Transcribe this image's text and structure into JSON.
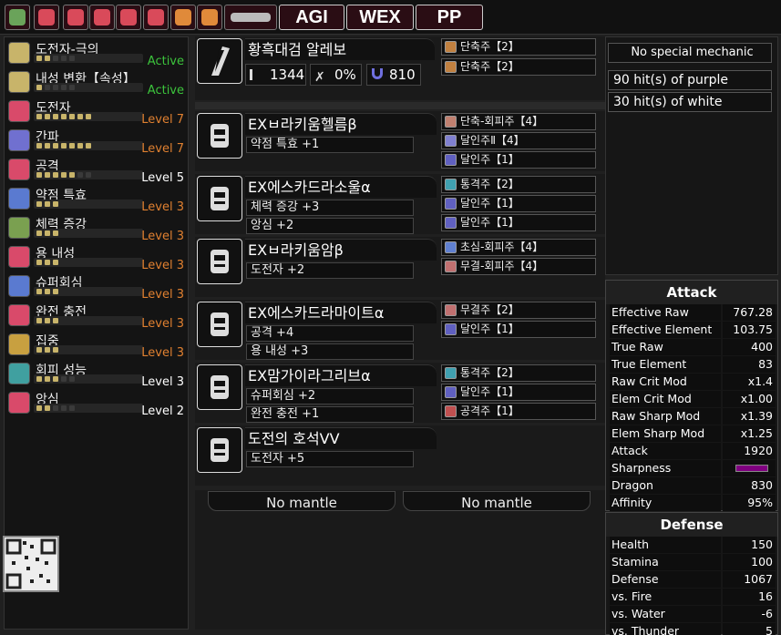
{
  "topbar": {
    "icons": [
      {
        "name": "slot-icon",
        "color": "#6aa35a"
      },
      {
        "name": "spoon-icon",
        "color": "#d94a5a"
      },
      {
        "name": "book-icon",
        "color": "#d94a5a"
      },
      {
        "name": "potion-icon",
        "color": "#d94a5a"
      },
      {
        "name": "pot-icon",
        "color": "#d94a5a"
      },
      {
        "name": "heart-icon",
        "color": "#d94a5a"
      },
      {
        "name": "flask-icon",
        "color": "#e08a3a"
      },
      {
        "name": "mustache-icon",
        "color": "#e08a3a"
      },
      {
        "name": "hammer-icon",
        "color": "#bbbbbb"
      }
    ],
    "buttons": [
      "AGI",
      "WEX",
      "PP"
    ]
  },
  "skills": [
    {
      "name": "도전자-극의",
      "level": "Active",
      "pips": [
        1,
        1,
        0,
        0,
        0
      ],
      "color": "#c8b46a",
      "level_color": "#3cc43c"
    },
    {
      "name": "내성 변환【속성】",
      "level": "Active",
      "pips": [
        1,
        0,
        0,
        0,
        0
      ],
      "color": "#c8b46a",
      "level_color": "#3cc43c"
    },
    {
      "name": "도전자",
      "level": "Level 7",
      "pips": [
        1,
        1,
        1,
        1,
        1,
        1,
        1
      ],
      "color": "#d94a6a",
      "level_color": "#e08030"
    },
    {
      "name": "간파",
      "level": "Level 7",
      "pips": [
        1,
        1,
        1,
        1,
        1,
        1,
        1
      ],
      "color": "#7070d0",
      "level_color": "#e08030"
    },
    {
      "name": "공격",
      "level": "Level 5",
      "pips": [
        1,
        1,
        1,
        1,
        1,
        0,
        0
      ],
      "color": "#d94a6a",
      "level_color": "#ffffff"
    },
    {
      "name": "약점 특효",
      "level": "Level 3",
      "pips": [
        1,
        1,
        1
      ],
      "color": "#5a7ad0",
      "level_color": "#e08030"
    },
    {
      "name": "체력 증강",
      "level": "Level 3",
      "pips": [
        1,
        1,
        1
      ],
      "color": "#7aa050",
      "level_color": "#e08030"
    },
    {
      "name": "용 내성",
      "level": "Level 3",
      "pips": [
        1,
        1,
        1
      ],
      "color": "#d94a6a",
      "level_color": "#e08030"
    },
    {
      "name": "슈퍼회심",
      "level": "Level 3",
      "pips": [
        1,
        1,
        1
      ],
      "color": "#5a7ad0",
      "level_color": "#e08030"
    },
    {
      "name": "완전 충전",
      "level": "Level 3",
      "pips": [
        1,
        1,
        1
      ],
      "color": "#d94a6a",
      "level_color": "#e08030"
    },
    {
      "name": "집중",
      "level": "Level 3",
      "pips": [
        1,
        1,
        1
      ],
      "color": "#c8a040",
      "level_color": "#e08030"
    },
    {
      "name": "회피 성능",
      "level": "Level 3",
      "pips": [
        1,
        1,
        1,
        0,
        0
      ],
      "color": "#40a0a0",
      "level_color": "#ffffff"
    },
    {
      "name": "앙심",
      "level": "Level 2",
      "pips": [
        1,
        1,
        0,
        0,
        0
      ],
      "color": "#d94a6a",
      "level_color": "#ffffff"
    }
  ],
  "weapon": {
    "name": "황흑대검 알레보",
    "attack": "1344",
    "affinity": "0%",
    "element": "810",
    "decos": [
      {
        "label": "단축주【2】",
        "color": "#c08040"
      },
      {
        "label": "단축주【2】",
        "color": "#c08040"
      }
    ]
  },
  "armor": [
    {
      "name": "EXㅂ라키움헬름β",
      "skills": [
        "약점 특효 +1"
      ],
      "decos": [
        {
          "label": "단축-회피주【4】",
          "color": "#c08070"
        },
        {
          "label": "달인주Ⅱ【4】",
          "color": "#8080d0"
        },
        {
          "label": "달인주【1】",
          "color": "#6060c0"
        }
      ]
    },
    {
      "name": "EX에스카드라소울α",
      "skills": [
        "체력 증강 +3",
        "앙심 +2"
      ],
      "decos": [
        {
          "label": "통격주【2】",
          "color": "#40a0b0"
        },
        {
          "label": "달인주【1】",
          "color": "#6060c0"
        },
        {
          "label": "달인주【1】",
          "color": "#6060c0"
        }
      ]
    },
    {
      "name": "EXㅂ라키움암β",
      "skills": [
        "도전자 +2"
      ],
      "decos": [
        {
          "label": "초심-회피주【4】",
          "color": "#6080d0"
        },
        {
          "label": "무결-회피주【4】",
          "color": "#c07070"
        }
      ]
    },
    {
      "name": "EX에스카드라마이트α",
      "skills": [
        "공격 +4",
        "용 내성 +3"
      ],
      "decos": [
        {
          "label": "무결주【2】",
          "color": "#c07070"
        },
        {
          "label": "달인주【1】",
          "color": "#6060c0"
        }
      ]
    },
    {
      "name": "EX맘가이라그리브α",
      "skills": [
        "슈퍼회심 +2",
        "완전 충전 +1"
      ],
      "decos": [
        {
          "label": "통격주【2】",
          "color": "#40a0b0"
        },
        {
          "label": "달인주【1】",
          "color": "#6060c0"
        },
        {
          "label": "공격주【1】",
          "color": "#c05050"
        }
      ]
    },
    {
      "name": "도전의 호석ⅤⅤ",
      "skills": [
        "도전자 +5"
      ],
      "decos": []
    }
  ],
  "mantles": [
    "No mantle",
    "No mantle"
  ],
  "info": {
    "mechanic": "No special mechanic",
    "purple": "90 hit(s) of purple",
    "white": "30 hit(s) of white"
  },
  "attack": {
    "title": "Attack",
    "rows": [
      [
        "Effective Raw",
        "767.28"
      ],
      [
        "Effective Element",
        "103.75"
      ],
      [
        "True Raw",
        "400"
      ],
      [
        "True Element",
        "83"
      ],
      [
        "Raw Crit Mod",
        "x1.4"
      ],
      [
        "Elem Crit Mod",
        "x1.00"
      ],
      [
        "Raw Sharp Mod",
        "x1.39"
      ],
      [
        "Elem Sharp Mod",
        "x1.25"
      ],
      [
        "Attack",
        "1920"
      ],
      [
        "Sharpness",
        ""
      ],
      [
        "Dragon",
        "830"
      ],
      [
        "Affinity",
        "95%"
      ]
    ]
  },
  "defense": {
    "title": "Defense",
    "rows": [
      [
        "Health",
        "150"
      ],
      [
        "Stamina",
        "100"
      ],
      [
        "Defense",
        "1067"
      ],
      [
        "vs. Fire",
        "16"
      ],
      [
        "vs. Water",
        "-6"
      ],
      [
        "vs. Thunder",
        "5"
      ]
    ]
  }
}
